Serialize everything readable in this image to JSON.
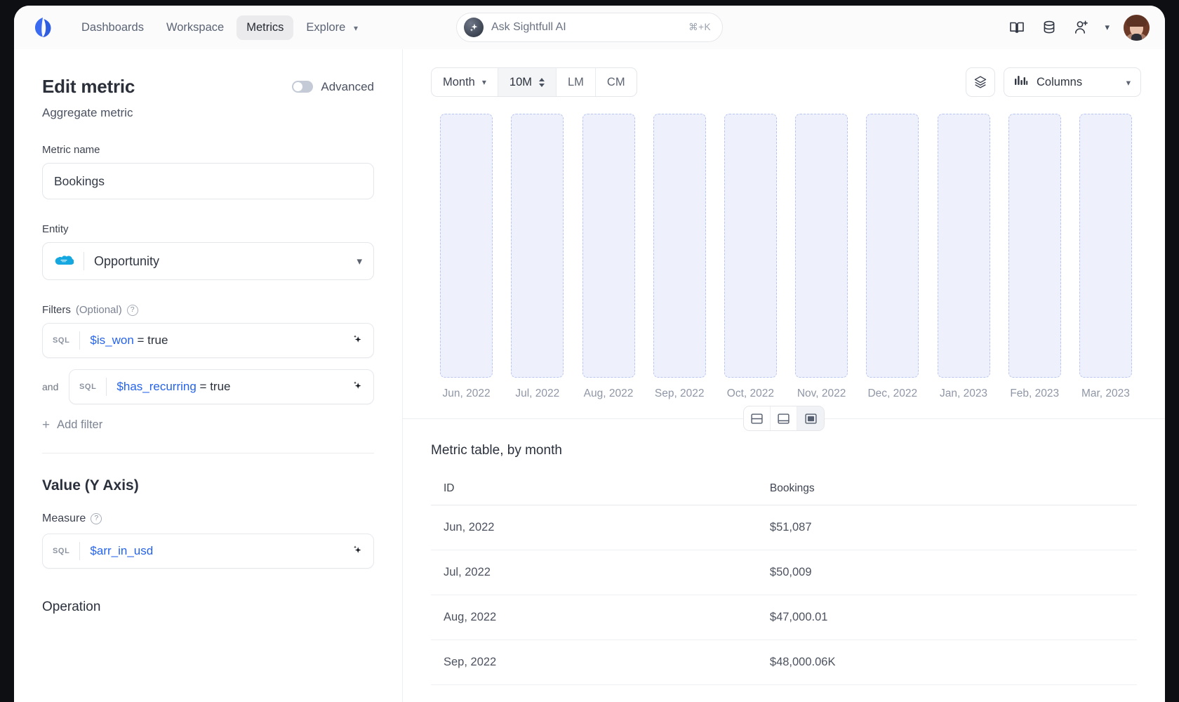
{
  "nav": {
    "brand_icon": "sightfull-logo-icon",
    "items": [
      {
        "label": "Dashboards",
        "active": false,
        "caret": false
      },
      {
        "label": "Workspace",
        "active": false,
        "caret": false
      },
      {
        "label": "Metrics",
        "active": true,
        "caret": false
      },
      {
        "label": "Explore",
        "active": false,
        "caret": true
      }
    ],
    "search": {
      "placeholder": "Ask Sightfull AI",
      "shortcut": "⌘+K",
      "icon": "ai-sparkle-icon"
    },
    "right_icons": [
      "book-icon",
      "database-icon",
      "add-user-icon",
      "chevron-down-icon"
    ],
    "avatar": "user-avatar"
  },
  "editor": {
    "title": "Edit metric",
    "subtitle": "Aggregate metric",
    "advanced_label": "Advanced",
    "advanced_on": false,
    "metric_name_label": "Metric name",
    "metric_name_value": "Bookings",
    "entity_label": "Entity",
    "entity_value": "Opportunity",
    "entity_icon": "salesforce-icon",
    "filters_label": "Filters",
    "filters_optional": "(Optional)",
    "filters": [
      {
        "connector": "",
        "tag": "SQL",
        "variable": "$is_won",
        "expression": " = true"
      },
      {
        "connector": "and",
        "tag": "SQL",
        "variable": "$has_recurring",
        "expression": " = true"
      }
    ],
    "add_filter_label": "Add filter",
    "value_section_title": "Value (Y Axis)",
    "measure_label": "Measure",
    "measure": {
      "tag": "SQL",
      "variable": "$arr_in_usd",
      "expression": ""
    },
    "operation_label": "Operation"
  },
  "chart_toolbar": {
    "period": "Month",
    "range": "10M",
    "lm": "LM",
    "cm": "CM",
    "layers_icon": "layers-icon",
    "chart_type_icon": "bar-chart-icon",
    "chart_type": "Columns"
  },
  "layout_toggle": {
    "options": [
      "split-even-layout",
      "split-bottom-layout",
      "full-table-layout"
    ],
    "selected": 2
  },
  "table": {
    "title": "Metric table, by month",
    "columns": [
      "ID",
      "Bookings"
    ],
    "rows": [
      [
        "Jun, 2022",
        "$51,087"
      ],
      [
        "Jul, 2022",
        "$50,009"
      ],
      [
        "Aug, 2022",
        "$47,000.01"
      ],
      [
        "Sep, 2022",
        "$48,000.06K"
      ]
    ]
  },
  "chart_data": {
    "type": "bar",
    "title": "",
    "xlabel": "",
    "ylabel": "",
    "state": "loading-placeholder",
    "categories": [
      "Jun, 2022",
      "Jul, 2022",
      "Aug, 2022",
      "Sep, 2022",
      "Oct, 2022",
      "Nov, 2022",
      "Dec, 2022",
      "Jan, 2023",
      "Feb, 2023",
      "Mar, 2023"
    ],
    "values": [
      null,
      null,
      null,
      null,
      null,
      null,
      null,
      null,
      null,
      null
    ],
    "legend": [],
    "grid": false,
    "bar_fill": "#eef1fc",
    "bar_border": "#b9c6f2"
  },
  "colors": {
    "accent": "#2563eb",
    "text": "#2b313c",
    "muted": "#8f96a5",
    "border": "#e4e6ea"
  }
}
